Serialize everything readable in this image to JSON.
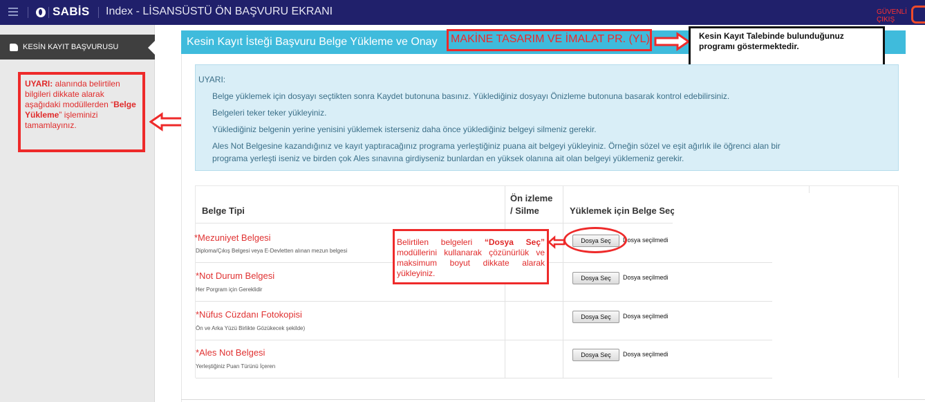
{
  "topbar": {
    "brand": "SABİS",
    "title": "Index - LİSANSÜSTÜ ÖN BAŞVURU EKRANI",
    "logout": "GÜVENLİ ÇIKIŞ"
  },
  "sidebar": {
    "item_label": "KESİN KAYIT BAŞVURUSU",
    "warning": {
      "prefix": "UYARI:",
      "text_1": " alanında belirtilen bilgileri dikkate alarak aşağıdaki modüllerden “",
      "emphasis": "Belge Yükleme",
      "text_2": "” işleminizi tamamlayınız."
    }
  },
  "panel": {
    "title": "Kesin Kayıt İsteği Başvuru Belge Yükleme ve Onay",
    "program": "MAKİNE TASARIM VE İMALAT PR. (YL)"
  },
  "program_callout": "Kesin Kayıt Talebinde bulunduğunuz programı göstermektedir.",
  "alert": {
    "heading": "UYARI:",
    "lines": [
      "Belge yüklemek için dosyayı seçtikten sonra Kaydet butonuna basınız. Yüklediğiniz dosyayı Önizleme butonuna basarak kontrol edebilirsiniz.",
      "Belgeleri teker teker yükleyiniz.",
      "Yüklediğiniz belgenin yerine yenisini yüklemek isterseniz daha önce yüklediğiniz belgeyi silmeniz gerekir.",
      "Ales Not Belgesine kazandığınız ve kayıt yaptıracağınız programa yerleştiğiniz puana ait belgeyi yükleyiniz. Örneğin sözel ve eşit ağırlık ile öğrenci alan bir",
      "programa yerleşti iseniz ve birden çok Ales sınavına girdiyseniz bunlardan en yüksek olanına ait olan belgeyi yüklemeniz gerekir."
    ]
  },
  "table": {
    "headers": {
      "type": "Belge Tipi",
      "preview_1": "Ön izleme",
      "preview_2": "/ Silme",
      "upload": "Yüklemek için Belge Seç"
    },
    "rows": [
      {
        "name": "*Mezuniyet Belgesi",
        "desc": "Diploma/Çıkış Belgesi veya E-Devletten alınan mezun belgesi"
      },
      {
        "name": "*Not Durum Belgesi",
        "desc": "Her Porgram için Gereklidir"
      },
      {
        "name": "*Nüfus Cüzdanı Fotokopisi",
        "desc": "Ön ve Arka Yüzü Birlikte Gözükecek şekilde)"
      },
      {
        "name": "*Ales Not Belgesi",
        "desc": "Yerleştiğiniz Puan Türünü İçeren"
      }
    ],
    "file_button_label": "Dosya Seç",
    "file_status": "Dosya seçilmedi"
  },
  "file_callout": {
    "text_1": "Belirtilen belgeleri ",
    "emphasis": "“Dosya Seç”",
    "text_2": " modüllerini kullanarak çözünürlük ve maksimum boyut dikkate alarak yükleyiniz."
  },
  "colors": {
    "navbar": "#20206b",
    "panel_header": "#3fbbdc",
    "annotation_red": "#ee2a2a",
    "alert_bg": "#d9eef7"
  }
}
